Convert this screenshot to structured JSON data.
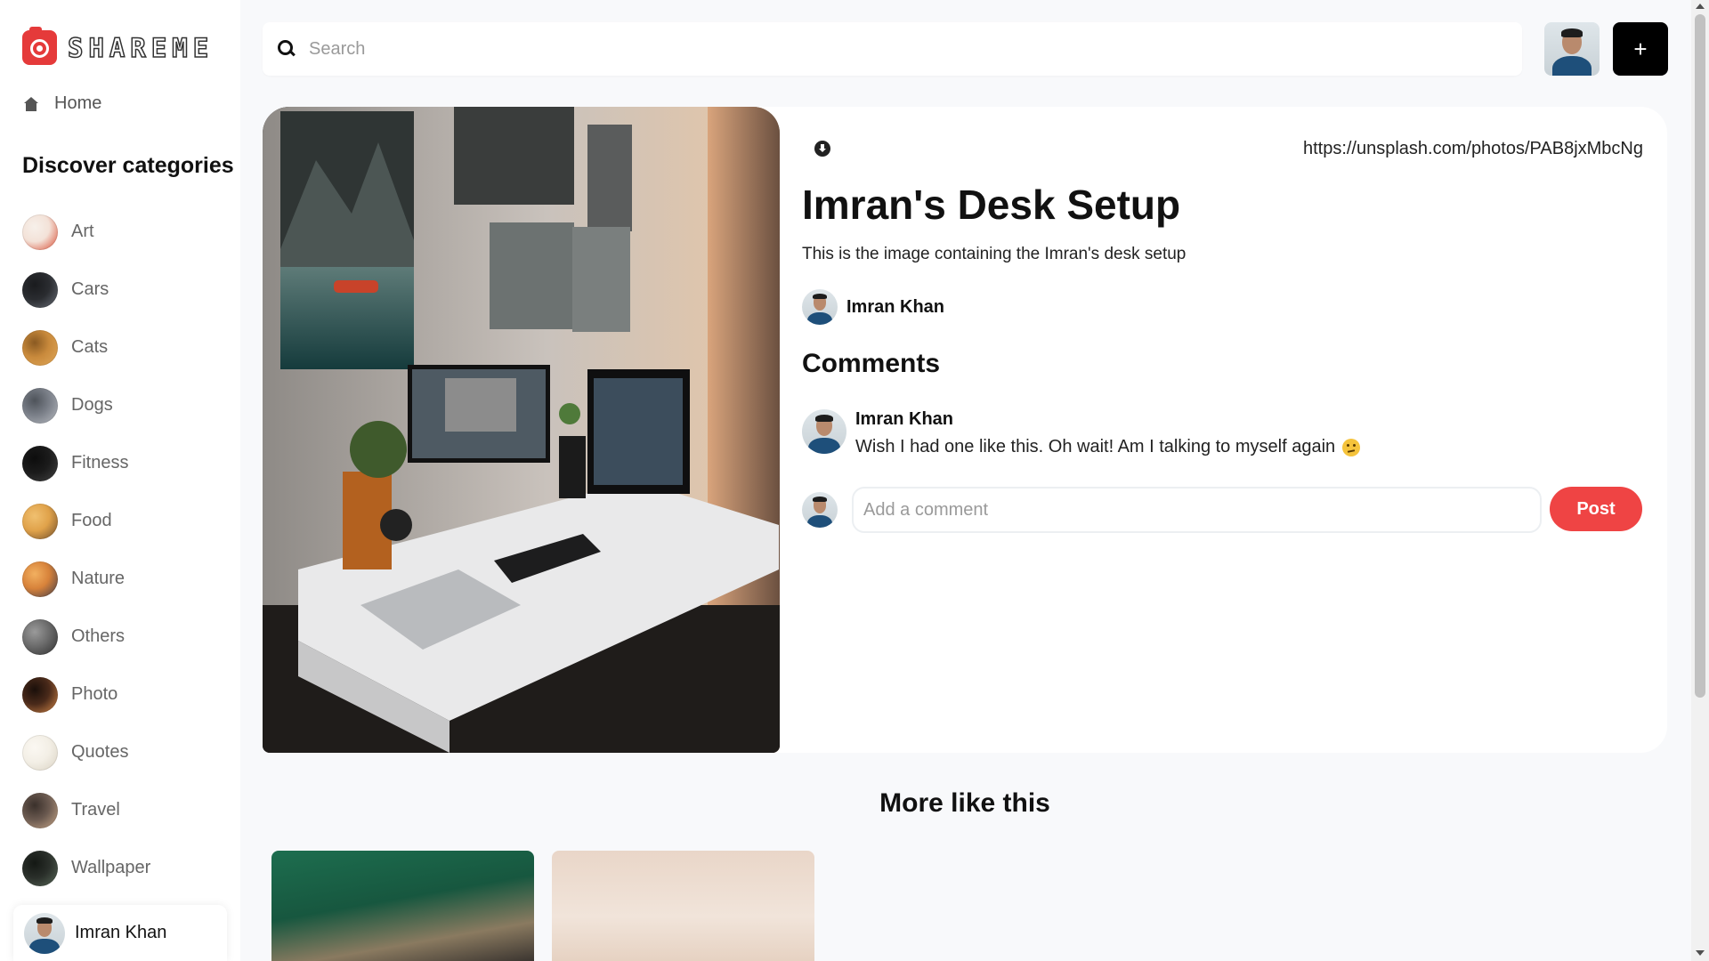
{
  "app": {
    "brand": "SHAREME"
  },
  "sidebar": {
    "home_label": "Home",
    "discover_title": "Discover categories",
    "categories": [
      {
        "label": "Art",
        "colors": [
          "#f3e2d8",
          "#d8452b",
          "#f7f0ea"
        ]
      },
      {
        "label": "Cars",
        "colors": [
          "#2a2c30",
          "#6a6f78",
          "#1a1b1e"
        ]
      },
      {
        "label": "Cats",
        "colors": [
          "#c98a3c",
          "#e0a85a",
          "#8a5a22"
        ]
      },
      {
        "label": "Dogs",
        "colors": [
          "#7a7f88",
          "#b9bcc2",
          "#4e535a"
        ]
      },
      {
        "label": "Fitness",
        "colors": [
          "#1b1b1b",
          "#444444",
          "#0d0d0d"
        ]
      },
      {
        "label": "Food",
        "colors": [
          "#e0a24a",
          "#6b4a2a",
          "#f0c070"
        ]
      },
      {
        "label": "Nature",
        "colors": [
          "#d7823a",
          "#3a3a4a",
          "#f2b060"
        ]
      },
      {
        "label": "Others",
        "colors": [
          "#6b6b6b",
          "#2d2d2d",
          "#9a9a9a"
        ]
      },
      {
        "label": "Photo",
        "colors": [
          "#4a2a1a",
          "#d88a4a",
          "#1a0f0a"
        ]
      },
      {
        "label": "Quotes",
        "colors": [
          "#f3efe6",
          "#d9d2c2",
          "#fbf8f2"
        ]
      },
      {
        "label": "Travel",
        "colors": [
          "#6b5a50",
          "#c9a88a",
          "#3a302b"
        ]
      },
      {
        "label": "Wallpaper",
        "colors": [
          "#2a2f2a",
          "#5a6a5a",
          "#141814"
        ]
      }
    ],
    "user_name": "Imran Khan"
  },
  "search": {
    "placeholder": "Search"
  },
  "header": {
    "add_label": "+"
  },
  "pin": {
    "source_url": "https://unsplash.com/photos/PAB8jxMbcNg",
    "title": "Imran's Desk Setup",
    "description": "This is the image containing the Imran's desk setup",
    "author": "Imran Khan",
    "comments_title": "Comments",
    "comments": [
      {
        "author": "Imran Khan",
        "text": "Wish I had one like this. Oh wait! Am I talking to myself again"
      }
    ],
    "comment_placeholder": "Add a comment",
    "post_label": "Post"
  },
  "more": {
    "title": "More like this"
  },
  "colors": {
    "accent_red": "#ef4444",
    "brand_red": "#e53a3a",
    "background": "#f8f9fb"
  }
}
